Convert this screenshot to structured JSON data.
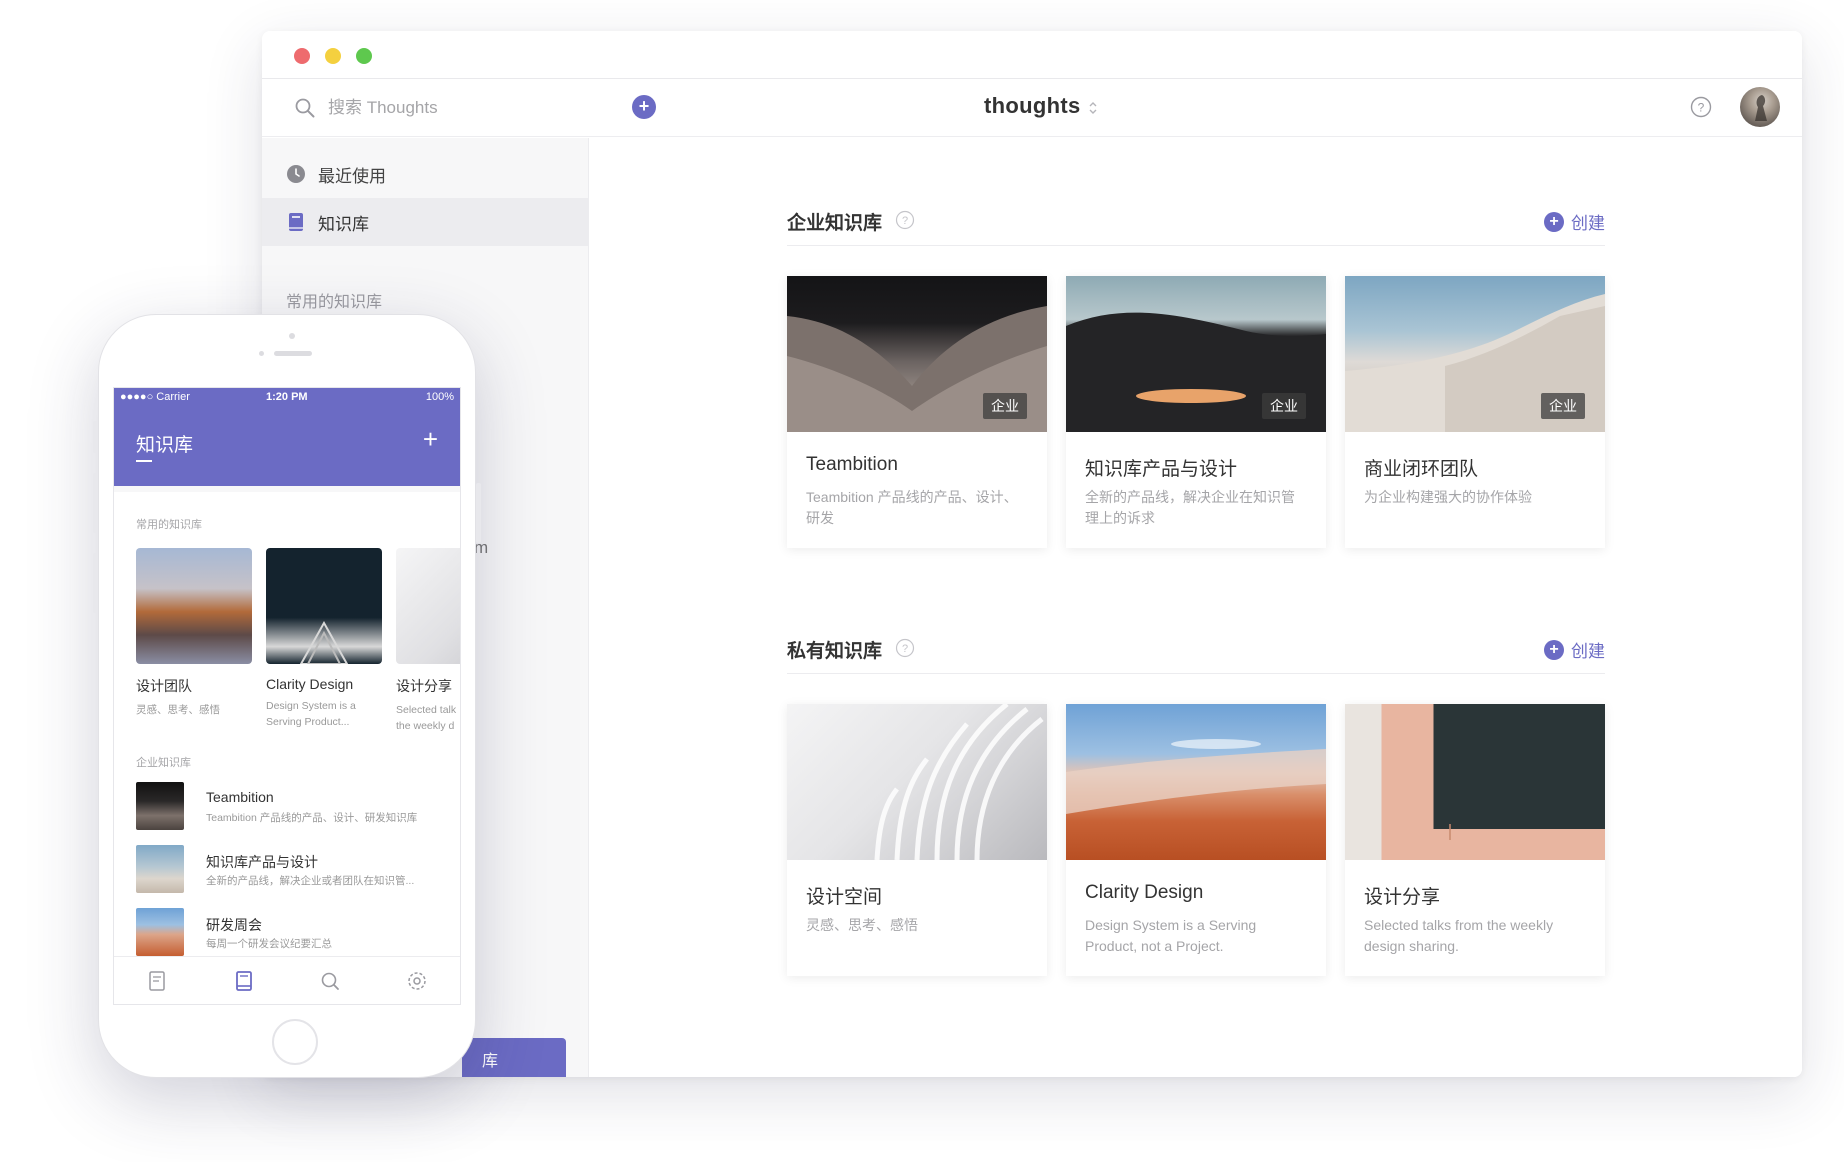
{
  "app": {
    "title": "thoughts"
  },
  "search": {
    "placeholder": "搜索 Thoughts"
  },
  "sidebar": {
    "items": [
      {
        "label": "最近使用",
        "icon": "clock-icon"
      },
      {
        "label": "知识库",
        "icon": "book-icon"
      }
    ],
    "section_label": "常用的知识库",
    "peek_text": "m",
    "cta_label": "库"
  },
  "enterprise": {
    "title": "企业知识库",
    "create_label": "创建",
    "cards": [
      {
        "title": "Teambition",
        "desc": "Teambition 产品线的产品、设计、研发",
        "badge": "企业"
      },
      {
        "title": "知识库产品与设计",
        "desc": "全新的产品线，解决企业在知识管理上的诉求",
        "badge": "企业"
      },
      {
        "title": "商业闭环团队",
        "desc": "为企业构建强大的协作体验",
        "badge": "企业"
      }
    ]
  },
  "private": {
    "title": "私有知识库",
    "create_label": "创建",
    "cards": [
      {
        "title": "设计空间",
        "desc": "灵感、思考、感悟"
      },
      {
        "title": "Clarity Design",
        "desc": "Design System is a Serving Product, not a Project."
      },
      {
        "title": "设计分享",
        "desc": "Selected talks from the weekly design sharing."
      }
    ]
  },
  "mobile": {
    "status": {
      "carrier": "●●●●○ Carrier",
      "time": "1:20 PM",
      "battery": "100%"
    },
    "title": "知识库",
    "plus": "+",
    "favorites_label": "常用的知识库",
    "favorites": [
      {
        "title": "设计团队",
        "desc_line1": "灵感、思考、感悟",
        "desc_line2": ""
      },
      {
        "title": "Clarity Design",
        "desc_line1": "Design System is a",
        "desc_line2": "Serving Product..."
      },
      {
        "title": "设计分享",
        "desc_line1": "Selected talk",
        "desc_line2": "the weekly d"
      }
    ],
    "enterprise_label": "企业知识库",
    "list": [
      {
        "title": "Teambition",
        "desc": "Teambition 产品线的产品、设计、研发知识库"
      },
      {
        "title": "知识库产品与设计",
        "desc": "全新的产品线，解决企业或者团队在知识管..."
      },
      {
        "title": "研发周会",
        "desc": "每周一个研发会议纪要汇总"
      }
    ],
    "tabs": [
      "document-icon",
      "book-icon",
      "search-icon",
      "settings-icon"
    ]
  },
  "colors": {
    "accent": "#6b6bc4",
    "sidebar_bg": "#f7f7f8"
  }
}
